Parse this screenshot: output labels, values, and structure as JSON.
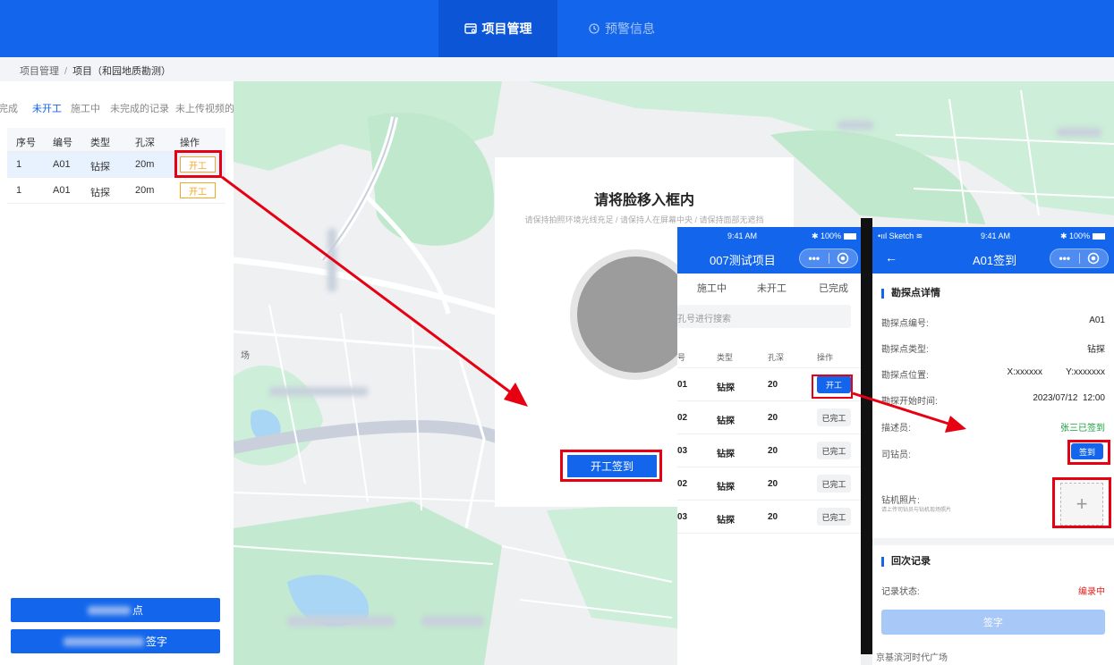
{
  "nav": {
    "tabs": [
      {
        "label": "项目管理"
      },
      {
        "label": "预警信息"
      }
    ]
  },
  "breadcrumb": {
    "root": "项目管理",
    "current": "项目（和园地质勘测）"
  },
  "left_panel": {
    "tabs": [
      "完成",
      "未开工",
      "施工中",
      "未完成的记录",
      "未上传视频的"
    ],
    "table": {
      "headers": [
        "序号",
        "编号",
        "类型",
        "孔深",
        "操作"
      ],
      "rows": [
        {
          "index": "1",
          "code": "A01",
          "type": "钻探",
          "depth": "20m",
          "action": "开工"
        },
        {
          "index": "1",
          "code": "A01",
          "type": "钻探",
          "depth": "20m",
          "action": "开工"
        }
      ]
    },
    "bottom_buttons": [
      "点",
      "签字"
    ]
  },
  "map_labels": {
    "left_fragment": "场",
    "bottom_text": "京基滨河时代广场"
  },
  "face_dialog": {
    "title": "请将脸移入框内",
    "subtitle": "请保持拍照环境光线充足 / 请保持人在屏幕中央 / 请保持面部无遮挡",
    "button": "开工签到"
  },
  "phone1": {
    "time": "9:41 AM",
    "battery": "100%",
    "title": "007测试项目",
    "tabs": [
      "施工中",
      "未开工",
      "已完成"
    ],
    "search_placeholder": "孔号进行搜索",
    "table": {
      "headers": [
        "号",
        "类型",
        "孔深",
        "操作"
      ],
      "rows": [
        {
          "no": "01",
          "type": "钻探",
          "depth": "20",
          "action": "开工",
          "primary": true
        },
        {
          "no": "02",
          "type": "钻探",
          "depth": "20",
          "action": "已完工",
          "primary": false
        },
        {
          "no": "03",
          "type": "钻探",
          "depth": "20",
          "action": "已完工",
          "primary": false
        },
        {
          "no": "02",
          "type": "钻探",
          "depth": "20",
          "action": "已完工",
          "primary": false
        },
        {
          "no": "03",
          "type": "钻探",
          "depth": "20",
          "action": "已完工",
          "primary": false
        }
      ]
    }
  },
  "phone2": {
    "carrier": "Sketch",
    "time": "9:41 AM",
    "battery": "100%",
    "title": "A01签到",
    "section1": "勘探点详情",
    "fields": {
      "code_label": "勘探点编号:",
      "code_value": "A01",
      "type_label": "勘探点类型:",
      "type_value": "钻探",
      "pos_label": "勘探点位置:",
      "pos_x": "X:xxxxxx",
      "pos_y": "Y:xxxxxxx",
      "start_label": "勘探开始时间:",
      "start_value": "2023/07/12  12:00",
      "desc_label": "描述员:",
      "desc_value": "张三已签到",
      "driller_label": "司钻员:",
      "driller_button": "签到",
      "photo_label": "钻机照片:",
      "photo_hint": "请上传司钻员与钻机现场照片"
    },
    "section2": "回次记录",
    "record_label": "记录状态:",
    "record_value": "编录中",
    "submit": "签字"
  },
  "colors": {
    "primary": "#1366ec",
    "highlight": "#e60012",
    "warning": "#f5a623",
    "success": "#1a9e3f",
    "danger": "#e02020"
  }
}
